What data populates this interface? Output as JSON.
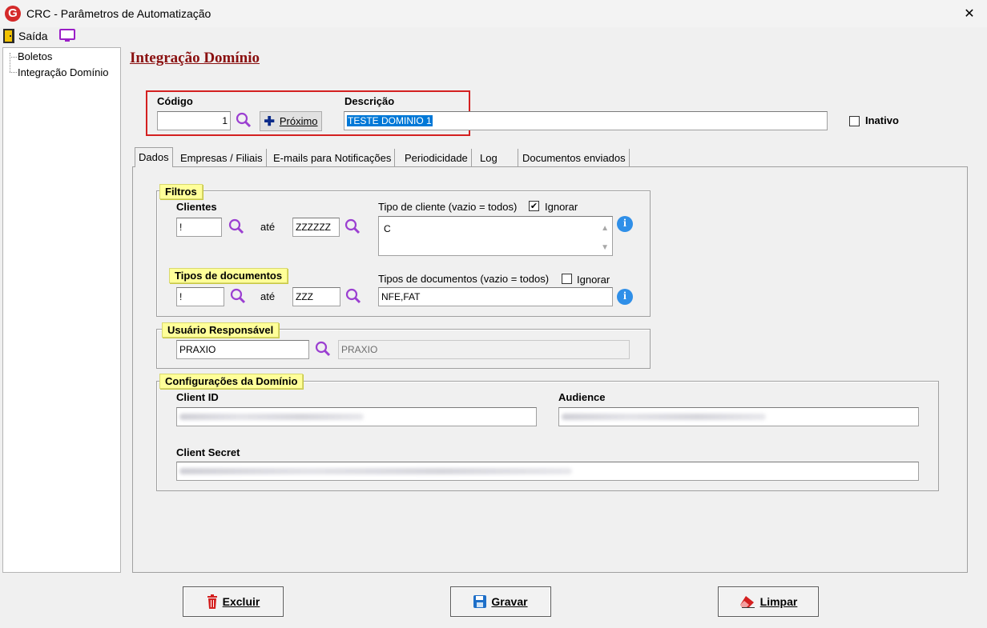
{
  "window": {
    "title": "CRC - Parâmetros de Automatização",
    "close": "✕"
  },
  "menu": {
    "exit_label": "Saída"
  },
  "tree": {
    "items": [
      "Boletos",
      "Integração Domínio"
    ]
  },
  "page_title": "Integração Domínio",
  "header": {
    "codigo_label": "Código",
    "codigo_value": "1",
    "proximo_label": "Próximo",
    "descricao_label": "Descrição",
    "descricao_value": "TESTE DOMINIO 1",
    "inativo_label": "Inativo"
  },
  "tabs": [
    "Dados",
    "Empresas / Filiais",
    "E-mails para Notificações",
    "Periodicidade",
    "Log",
    "Documentos enviados"
  ],
  "filtros": {
    "legend": "Filtros",
    "clientes_label": "Clientes",
    "cliente_from": "!",
    "ate": "até",
    "cliente_to": "ZZZZZZ",
    "tipo_cliente_label": "Tipo de cliente (vazio = todos)",
    "ignorar_label": "Ignorar",
    "ignorar_cliente_checked": "✔",
    "tipo_cliente_value": "C",
    "tipos_doc_legend": "Tipos de documentos",
    "tipo_doc_from": "!",
    "tipo_doc_to": "ZZZ",
    "tipos_doc_label": "Tipos de documentos (vazio = todos)",
    "tipos_doc_value": "NFE,FAT"
  },
  "usuario": {
    "legend": "Usuário Responsável",
    "code": "PRAXIO",
    "name": "PRAXIO"
  },
  "config": {
    "legend": "Configurações da Domínio",
    "client_id_label": "Client ID",
    "audience_label": "Audience",
    "client_secret_label": "Client Secret"
  },
  "buttons": {
    "excluir": "Excluir",
    "gravar": "Gravar",
    "limpar": "Limpar"
  },
  "colors": {
    "title_red": "#8a1010",
    "legend_yellow": "#ffff99",
    "highlight_red": "#d42020",
    "selection_blue": "#0078d7"
  }
}
